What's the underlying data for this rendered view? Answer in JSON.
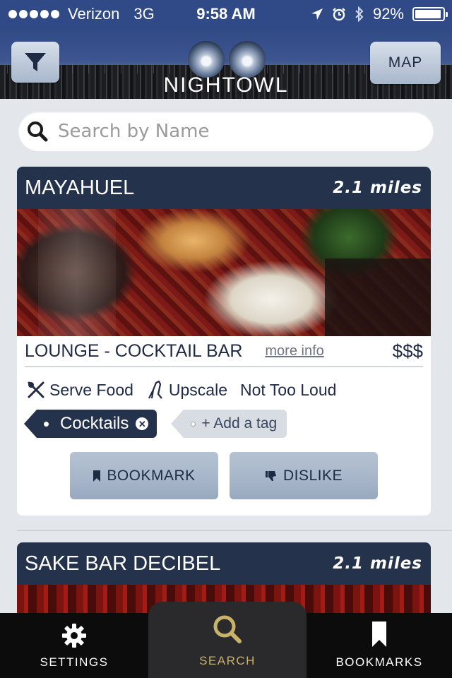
{
  "status_bar": {
    "carrier": "Verizon",
    "network": "3G",
    "time": "9:58 AM",
    "battery": "92%"
  },
  "header": {
    "brand": "NIGHTOWL",
    "map_label": "MAP"
  },
  "search": {
    "placeholder": "Search by Name"
  },
  "venues": [
    {
      "name": "MAYAHUEL",
      "distance": "2.1 miles",
      "type": "LOUNGE - COCKTAIL BAR",
      "more_info": "more info",
      "price": "$$$",
      "features": [
        {
          "label": "Serve Food",
          "icon": "fork-knife-icon"
        },
        {
          "label": "Upscale",
          "icon": "high-heel-icon"
        },
        {
          "label": "Not Too Loud",
          "icon": ""
        }
      ],
      "tags": [
        "Cocktails"
      ],
      "add_tag_label": "+ Add a tag",
      "bookmark_label": "BOOKMARK",
      "dislike_label": "DISLIKE"
    },
    {
      "name": "SAKE BAR DECIBEL",
      "distance": "2.1 miles"
    }
  ],
  "tabbar": {
    "settings": "SETTINGS",
    "search": "SEARCH",
    "bookmarks": "BOOKMARKS"
  },
  "colors": {
    "navy": "#25324c",
    "status_blue": "#2f4a86",
    "active_tab": "#c8b36a"
  }
}
